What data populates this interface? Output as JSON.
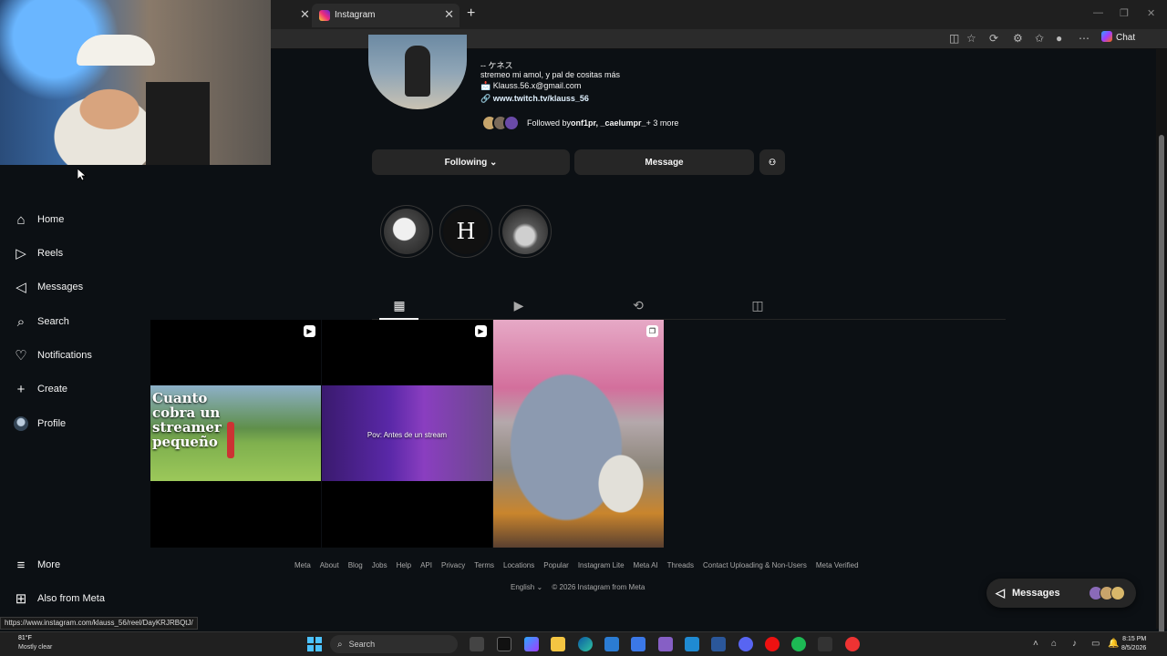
{
  "browser": {
    "tab_title": "Instagram",
    "tab_close": "✕",
    "prev_tab_close": "✕",
    "new_tab": "+",
    "chat_label": "Chat",
    "minimize": "—",
    "maximize": "❐",
    "close": "✕"
  },
  "sidebar": {
    "home": "Home",
    "reels": "Reels",
    "messages": "Messages",
    "search": "Search",
    "notifications": "Notifications",
    "create": "Create",
    "profile": "Profile",
    "more": "More",
    "also_from_meta": "Also from Meta"
  },
  "profile": {
    "name_line": "-- ケネス",
    "bio": "stremeo mi amol, y pal de cositas más",
    "email": "📩 Klauss.56.x@gmail.com",
    "link": "🔗 www.twitch.tv/klauss_56",
    "followed_by_prefix": "Followed by ",
    "followed_by_names": "onf1pr, _caelumpr_",
    "followed_by_more": " + 3 more",
    "following_button": "Following ⌄",
    "message_button": "Message",
    "add_user_icon": "⁺👤"
  },
  "highlights": [
    {
      "color": "#d9d9d9"
    },
    {
      "color": "#111111",
      "label": "H"
    },
    {
      "color": "#6a6a6a"
    }
  ],
  "profile_tabs": {
    "posts_icon": "▦",
    "reels_icon": "▶",
    "reposts_icon": "⟲",
    "tagged_icon": "◫"
  },
  "posts": [
    {
      "type": "reel",
      "overlay_text": "Cuanto cobra un streamer pequeño"
    },
    {
      "type": "reel",
      "overlay_text": "Pov: Antes de un stream"
    },
    {
      "type": "carousel"
    }
  ],
  "footer": {
    "links": [
      "Meta",
      "About",
      "Blog",
      "Jobs",
      "Help",
      "API",
      "Privacy",
      "Terms",
      "Locations",
      "Popular",
      "Instagram Lite",
      "Meta AI",
      "Threads",
      "Contact Uploading & Non-Users",
      "Meta Verified"
    ],
    "language": "English ⌄",
    "copyright": "© 2026 Instagram from Meta"
  },
  "messages_pill": {
    "label": "Messages"
  },
  "status_url": "https://www.instagram.com/klauss_56/reel/DayKRJRBQtJ/",
  "taskbar": {
    "temp": "81°F",
    "weather": "Mostly clear",
    "search_placeholder": "Search",
    "time": "8:15 PM",
    "date": "8/5/2026"
  },
  "colors": {
    "background": "#0c1014",
    "button_bg": "#262626",
    "text_primary": "#f5f5f5",
    "text_secondary": "#a8a8a8",
    "link": "#e0f1ff"
  }
}
